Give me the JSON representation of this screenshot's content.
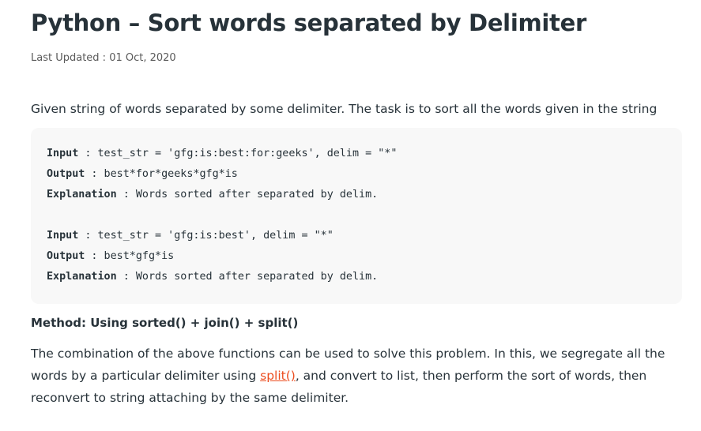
{
  "article": {
    "title": "Python – Sort words separated by Delimiter",
    "last_updated": "Last Updated : 01 Oct, 2020",
    "intro": "Given string of words separated by some delimiter. The task is to sort all the words given in the string",
    "examples": [
      {
        "input_label": "Input",
        "input_text": " : test_str = 'gfg:is:best:for:geeks', delim = \"*\"",
        "output_label": "Output",
        "output_text": " : best*for*geeks*gfg*is",
        "explanation_label": "Explanation",
        "explanation_text": " : Words sorted after separated by delim."
      },
      {
        "input_label": "Input",
        "input_text": " : test_str = 'gfg:is:best', delim = \"*\"",
        "output_label": "Output",
        "output_text": " : best*gfg*is",
        "explanation_label": "Explanation",
        "explanation_text": " : Words sorted after separated by delim."
      }
    ],
    "method_heading": "Method: Using sorted() + join() + split()",
    "paragraph": {
      "line1": "The combination of the above functions can be used to solve this problem. In this, we segregate all the",
      "line2_before": "words by a particular delimiter using ",
      "link_text": "split()",
      "line2_after": ", and convert to list, then perform the sort of words, then",
      "line3": "reconvert to string attaching by the same delimiter."
    }
  }
}
